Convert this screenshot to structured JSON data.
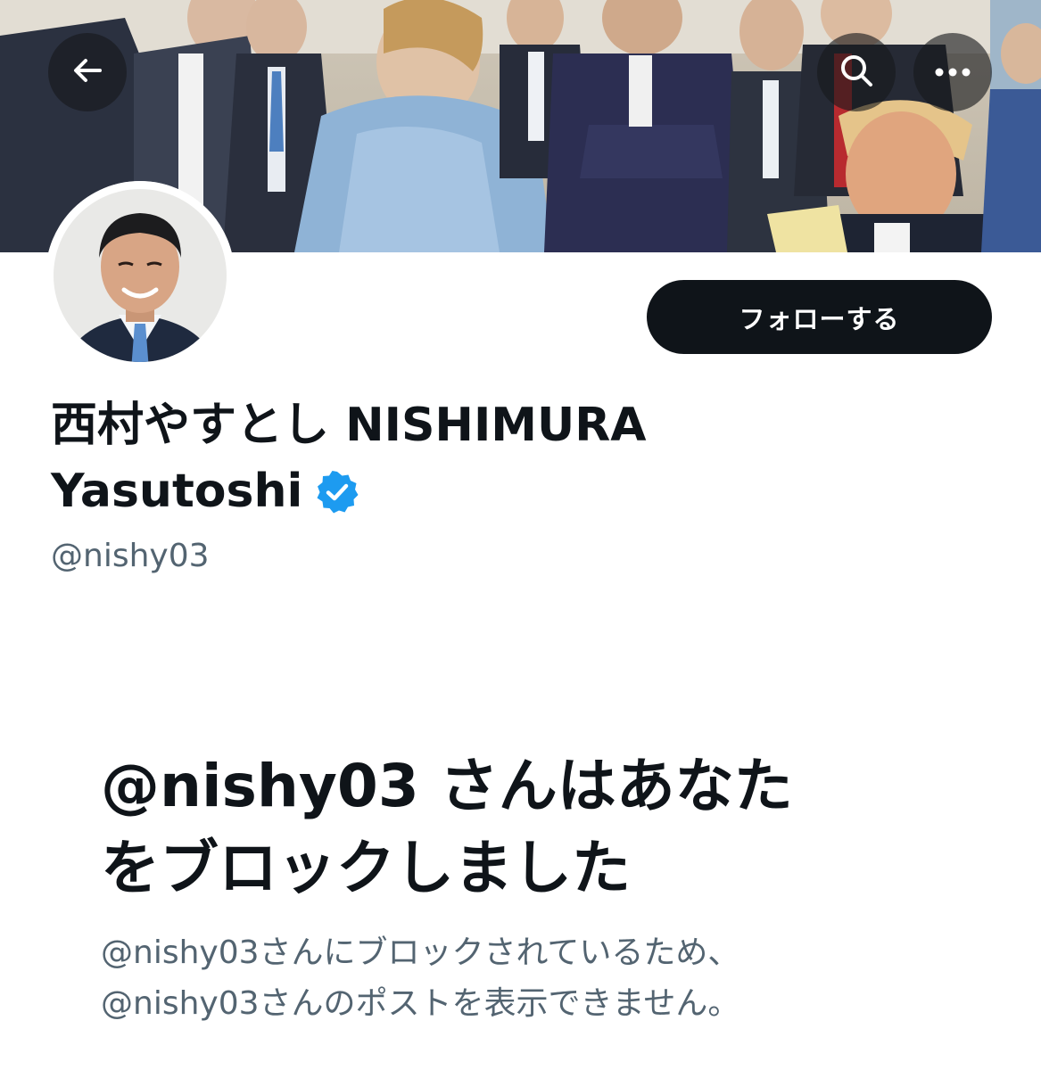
{
  "header": {
    "back_icon": "arrow-left-icon",
    "search_icon": "search-icon",
    "more_icon": "more-horizontal-icon"
  },
  "profile": {
    "display_name_line1": "西村やすとし NISHIMURA",
    "display_name_line2": "Yasutoshi",
    "verified_icon": "verified-badge-icon",
    "handle": "@nishy03",
    "follow_label": "フォローする"
  },
  "blocked": {
    "title_line1": "@nishy03 さんはあなた",
    "title_line2": "をブロックしました",
    "desc_line1": "@nishy03さんにブロックされているため、",
    "desc_line2": "@nishy03さんのポストを表示できません。"
  },
  "colors": {
    "primary_text": "#0f1419",
    "secondary_text": "#536471",
    "verified_blue": "#1d9bf0",
    "button_bg": "#0f1419",
    "button_text": "#ffffff"
  }
}
